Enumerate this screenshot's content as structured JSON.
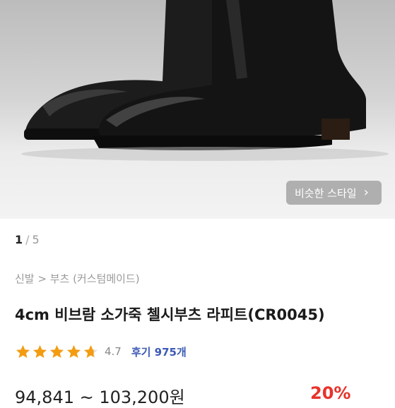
{
  "hero": {
    "similar_style_label": "비슷한 스타일",
    "similar_style_icon": "chevron-right-icon"
  },
  "pager": {
    "current": "1",
    "separator": "/",
    "total": "5"
  },
  "breadcrumb": "신발 > 부츠 (커스텀메이드)",
  "product": {
    "title": "4cm 비브람 소가죽 첼시부츠 라피트(CR0045)",
    "rating": 4.7,
    "rating_text": "4.7",
    "reviews_label": "후기 975개",
    "price_range": "94,841 ~ 103,200원",
    "discount": "20%"
  },
  "colors": {
    "star": "#f39c12",
    "review_link": "#3d5ab5",
    "discount": "#e8322b"
  }
}
